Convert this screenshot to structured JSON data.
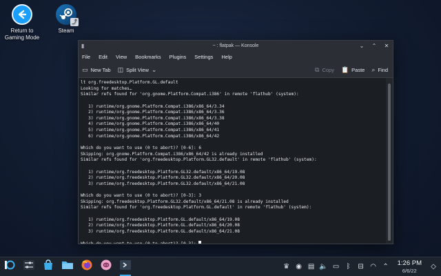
{
  "desktop": {
    "return_label_1": "Return to",
    "return_label_2": "Gaming Mode",
    "steam_label": "Steam"
  },
  "window": {
    "title": "~ : flatpak — Konsole",
    "menu": [
      "File",
      "Edit",
      "View",
      "Bookmarks",
      "Plugins",
      "Settings",
      "Help"
    ],
    "toolbar": {
      "new_tab": "New Tab",
      "split_view": "Split View",
      "copy": "Copy",
      "paste": "Paste",
      "find": "Find"
    }
  },
  "terminal": {
    "lines": [
      "lt org.freedesktop.Platform.GL.default",
      "Looking for matches…",
      "Similar refs found for 'org.gnome.Platform.Compat.i386' in remote 'flathub' (system):",
      "",
      "   1) runtime/org.gnome.Platform.Compat.i386/x86_64/3.34",
      "   2) runtime/org.gnome.Platform.Compat.i386/x86_64/3.36",
      "   3) runtime/org.gnome.Platform.Compat.i386/x86_64/3.38",
      "   4) runtime/org.gnome.Platform.Compat.i386/x86_64/40",
      "   5) runtime/org.gnome.Platform.Compat.i386/x86_64/41",
      "   6) runtime/org.gnome.Platform.Compat.i386/x86_64/42",
      "",
      "Which do you want to use (0 to abort)? [0-6]: 6",
      "Skipping: org.gnome.Platform.Compat.i386/x86_64/42 is already installed",
      "Similar refs found for 'org.freedesktop.Platform.GL32.default' in remote 'flathub' (system):",
      "",
      "   1) runtime/org.freedesktop.Platform.GL32.default/x86_64/19.08",
      "   2) runtime/org.freedesktop.Platform.GL32.default/x86_64/20.08",
      "   3) runtime/org.freedesktop.Platform.GL32.default/x86_64/21.08",
      "",
      "Which do you want to use (0 to abort)? [0-3]: 3",
      "Skipping: org.freedesktop.Platform.GL32.default/x86_64/21.08 is already installed",
      "Similar refs found for 'org.freedesktop.Platform.GL.default' in remote 'flathub' (system):",
      "",
      "   1) runtime/org.freedesktop.Platform.GL.default/x86_64/19.08",
      "   2) runtime/org.freedesktop.Platform.GL.default/x86_64/20.08",
      "   3) runtime/org.freedesktop.Platform.GL.default/x86_64/21.08",
      "",
      "Which do you want to use (0 to abort)? [0-3]: "
    ]
  },
  "taskbar": {
    "time": "1:26 PM",
    "date": "6/6/22"
  }
}
